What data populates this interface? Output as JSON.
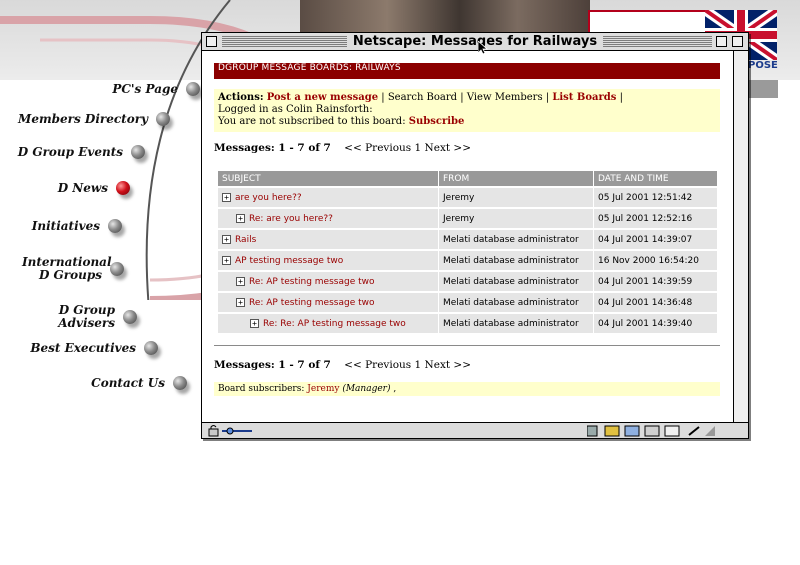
{
  "site_nav": [
    {
      "label": "PC's Page",
      "active": false
    },
    {
      "label": "Members Directory",
      "active": false
    },
    {
      "label": "D Group Events",
      "active": false
    },
    {
      "label": "D News",
      "active": true
    },
    {
      "label": "Initiatives",
      "active": false
    },
    {
      "label": "International D Groups",
      "active": false
    },
    {
      "label": "D Group Advisers",
      "active": false
    },
    {
      "label": "Best Executives",
      "active": false
    },
    {
      "label": "Contact Us",
      "active": false
    }
  ],
  "site_logo_fragment": "POSE",
  "window": {
    "title": "Netscape: Messages for Railways"
  },
  "board": {
    "title": "DGROUP MESSAGE BOARDS: RAILWAYS",
    "actions_label": "Actions:",
    "post_link": "Post a new message",
    "search_link": "Search Board",
    "view_members_link": "View Members",
    "list_boards_link": "List Boards",
    "logged_in": "Logged in as Colin Rainsforth:",
    "not_subscribed": "You are not subscribed to this board:",
    "subscribe_link": "Subscribe",
    "pager_label": "Messages: 1 - 7 of 7",
    "prev_link": "<< Previous",
    "page_num": "1",
    "next_link": "Next >>",
    "subscribers_label": "Board subscribers:",
    "subscriber_name": "Jeremy",
    "subscriber_role": "(Manager)",
    "subscribers_tail": ","
  },
  "table": {
    "headers": [
      "SUBJECT",
      "FROM",
      "DATE AND TIME"
    ],
    "rows": [
      {
        "subject": "are you here??",
        "from": "Jeremy",
        "date": "05 Jul 2001 12:51:42",
        "level": 0
      },
      {
        "subject": "Re: are you here??",
        "from": "Jeremy",
        "date": "05 Jul 2001 12:52:16",
        "level": 1
      },
      {
        "subject": "Rails",
        "from": "Melati database administrator",
        "date": "04 Jul 2001 14:39:07",
        "level": 0
      },
      {
        "subject": "AP testing message two",
        "from": "Melati database administrator",
        "date": "16 Nov 2000 16:54:20",
        "level": 0
      },
      {
        "subject": "Re: AP testing message two",
        "from": "Melati database administrator",
        "date": "04 Jul 2001 14:39:59",
        "level": 1
      },
      {
        "subject": "Re: AP testing message two",
        "from": "Melati database administrator",
        "date": "04 Jul 2001 14:36:48",
        "level": 1
      },
      {
        "subject": "Re: Re: AP testing message two",
        "from": "Melati database administrator",
        "date": "04 Jul 2001 14:39:40",
        "level": 2
      }
    ]
  },
  "colors": {
    "header_red": "#8b0000",
    "link_red": "#990000",
    "highlight_yellow": "#ffffcc",
    "table_header_grey": "#999999",
    "table_row_grey": "#e5e5e5"
  }
}
